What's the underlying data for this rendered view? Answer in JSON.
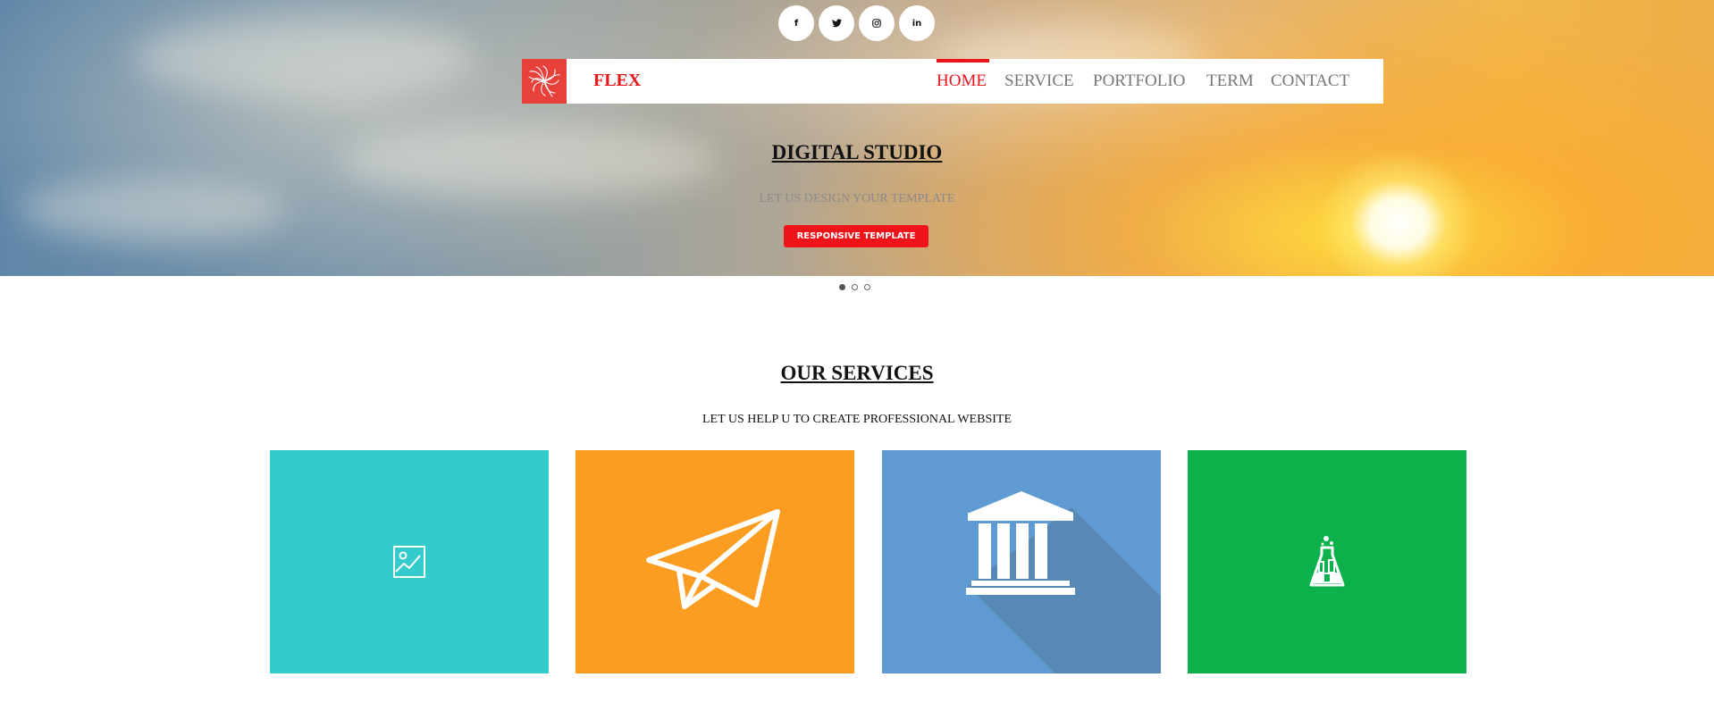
{
  "social": {
    "items": [
      {
        "name": "facebook",
        "glyph": "f"
      },
      {
        "name": "twitter",
        "glyph": "🐦"
      },
      {
        "name": "instagram",
        "glyph": "◎"
      },
      {
        "name": "linkedin",
        "glyph": "in"
      }
    ]
  },
  "navbar": {
    "brand": "FLEX",
    "logo_icon": "pinwheel-logo-icon",
    "items": [
      {
        "label": "HOME",
        "active": true
      },
      {
        "label": "SERVICE",
        "active": false
      },
      {
        "label": "PORTFOLIO",
        "active": false
      },
      {
        "label": "TERM",
        "active": false
      },
      {
        "label": "CONTACT",
        "active": false
      }
    ]
  },
  "hero": {
    "title": "DIGITAL STUDIO",
    "subtitle": "LET US DESIGN YOUR TEMPLATE",
    "button_label": "RESPONSIVE TEMPLATE",
    "slide_count": 3,
    "active_slide": 1
  },
  "services": {
    "title": "OUR SERVICES",
    "subtitle": "LET US HELP U TO CREATE PROFESSIONAL WEBSITE",
    "cards": [
      {
        "icon": "image-icon",
        "color": "#33cbcc"
      },
      {
        "icon": "paper-plane-icon",
        "color": "#fc9d21"
      },
      {
        "icon": "bank-building-icon",
        "color": "#5f9bd2"
      },
      {
        "icon": "flask-icon",
        "color": "#0db14b"
      }
    ]
  },
  "colors": {
    "accent": "#e8161b",
    "nav_text": "#777777"
  }
}
